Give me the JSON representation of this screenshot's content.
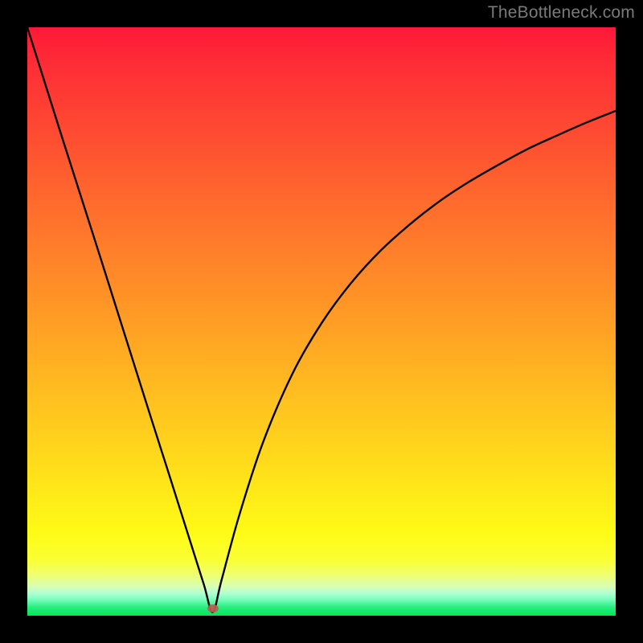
{
  "watermark": "TheBottleneck.com",
  "dot": {
    "x_frac": 0.315,
    "y_frac": 0.988
  },
  "chart_data": {
    "type": "line",
    "title": "",
    "xlabel": "",
    "ylabel": "",
    "x": [
      0.0,
      0.03,
      0.06,
      0.09,
      0.12,
      0.15,
      0.18,
      0.21,
      0.24,
      0.27,
      0.3,
      0.315,
      0.33,
      0.36,
      0.4,
      0.45,
      0.5,
      0.55,
      0.6,
      0.65,
      0.7,
      0.75,
      0.8,
      0.85,
      0.9,
      0.95,
      1.0
    ],
    "series": [
      {
        "name": "curve",
        "values": [
          1.0,
          0.905,
          0.81,
          0.716,
          0.622,
          0.527,
          0.432,
          0.337,
          0.243,
          0.148,
          0.053,
          0.006,
          0.06,
          0.17,
          0.293,
          0.41,
          0.497,
          0.565,
          0.62,
          0.665,
          0.704,
          0.737,
          0.766,
          0.793,
          0.816,
          0.838,
          0.858
        ]
      }
    ],
    "xlim": [
      0,
      1
    ],
    "ylim": [
      0,
      1
    ]
  }
}
